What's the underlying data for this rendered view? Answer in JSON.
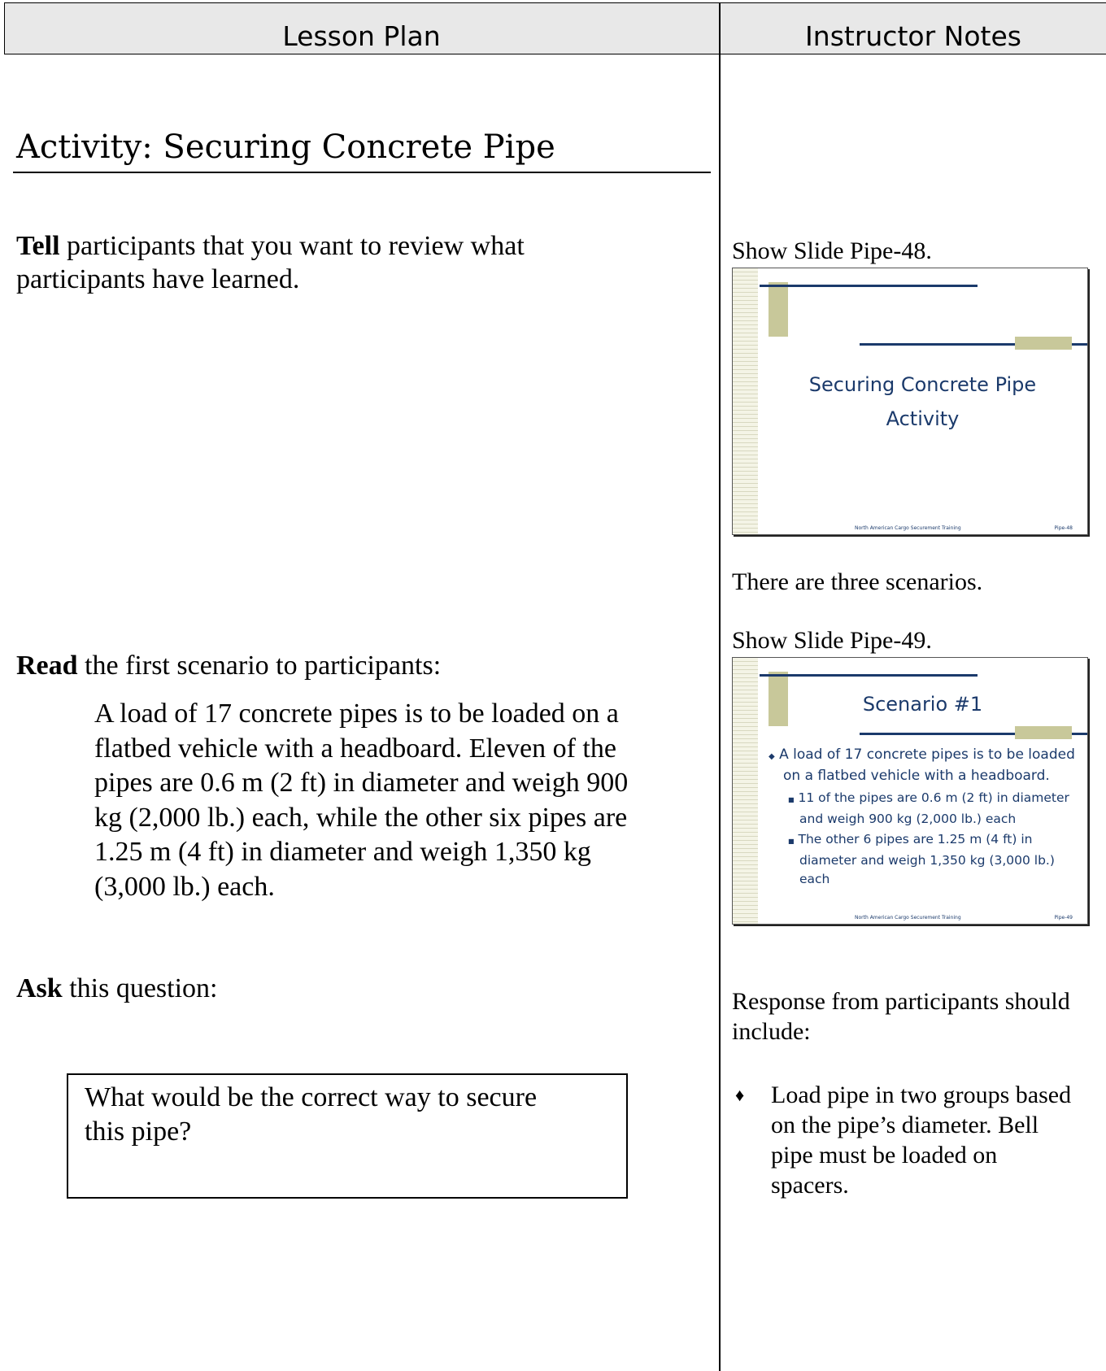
{
  "header": {
    "left_title": "Lesson Plan",
    "right_title": "Instructor Notes"
  },
  "lesson": {
    "section_title": "Activity: Securing Concrete Pipe",
    "tell": {
      "lead": "Tell",
      "line1": " participants that you want to review what",
      "line2": "participants have learned."
    },
    "read": {
      "lead": "Read",
      "rest": " the first scenario to participants:"
    },
    "scenario_lines": [
      "A load of 17 concrete pipes is to be loaded on a",
      "flatbed vehicle with a headboard.  Eleven of the",
      "pipes are 0.6 m (2 ft) in diameter and weigh 900",
      "kg (2,000 lb.) each, while the other six pipes are",
      "1.25 m (4 ft) in diameter and weigh 1,350 kg",
      "(3,000 lb.) each."
    ],
    "ask": {
      "lead": "Ask",
      "rest": " this question:"
    },
    "question_lines": [
      "What would be the correct way to secure",
      "this pipe?"
    ]
  },
  "notes": {
    "show_slide_48": "Show Slide Pipe-48.",
    "three_scenarios": "There are three scenarios.",
    "show_slide_49": "Show Slide Pipe-49.",
    "response_lines": [
      "Response from participants should",
      "include:"
    ],
    "bullet_glyph": "♦",
    "bullet_lines": [
      "Load pipe in two groups based",
      "on the pipe’s diameter. Bell",
      "pipe must be loaded on",
      "spacers."
    ]
  },
  "slide48": {
    "title_lines": [
      "Securing Concrete Pipe",
      "Activity"
    ],
    "footer": "North American Cargo Securement Training",
    "number": "Pipe-48"
  },
  "slide49": {
    "title": "Scenario #1",
    "bullet_main_marker": "◆",
    "bullet_main_lines": [
      "A load of 17 concrete pipes is to be loaded",
      "on a flatbed vehicle with a headboard."
    ],
    "sub_marker": "■",
    "sub1_lines": [
      "11 of the pipes are 0.6 m (2 ft) in diameter",
      "and weigh 900 kg (2,000 lb.) each"
    ],
    "sub2_lines": [
      "The other 6 pipes are 1.25 m (4 ft) in",
      "diameter and weigh 1,350 kg (3,000 lb.)",
      "each"
    ],
    "footer": "North American Cargo Securement Training",
    "number": "Pipe-49"
  },
  "colors": {
    "slide_text": "#1b3a6b",
    "slide_accent": "#c8c89a",
    "header_bg": "#e8e8e8"
  }
}
